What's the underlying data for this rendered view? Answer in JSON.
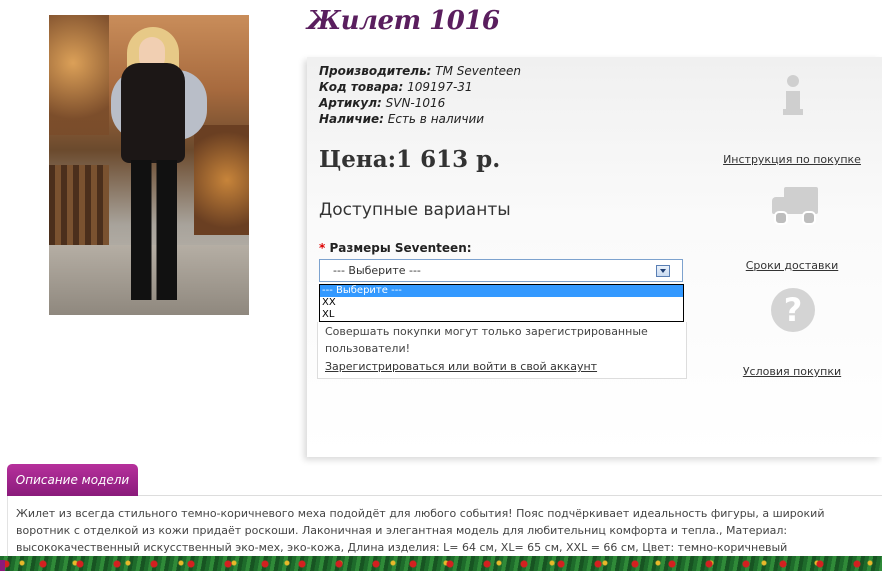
{
  "product": {
    "title": "Жилет 1016",
    "image_alt": "Жилет 1016"
  },
  "meta": {
    "manufacturer_label": "Производитель:",
    "manufacturer_value": "TM Seventeen",
    "code_label": "Код товара:",
    "code_value": "109197-31",
    "sku_label": "Артикул:",
    "sku_value": "SVN-1016",
    "availability_label": "Наличие:",
    "availability_value": "Есть в наличии"
  },
  "price": "Цена:1 613 р.",
  "variants": {
    "heading": "Доступные варианты",
    "required_mark": "*",
    "size_label": "Размеры Seventeen:",
    "selected": "--- Выберите ---",
    "options": [
      "--- Выберите ---",
      "XX",
      "XL"
    ]
  },
  "notice": {
    "text": "Совершать покупки могут только зарегистрированные пользователи!",
    "link": "Зарегистрироваться или войти в свой аккаунт"
  },
  "side_links": {
    "instructions": "Инструкция по покупке",
    "delivery": "Сроки доставки",
    "terms": "Условия покупки",
    "question_glyph": "?"
  },
  "description": {
    "tab_label": "Описание модели",
    "text": "Жилет из всегда стильного темно-коричневого меха подойдёт для любого события! Пояс подчёркивает идеальность фигуры, а широкий воротник с отделкой из кожи придаёт роскоши. Лаконичная и элегантная модель для любительниц комфорта и тепла., Материал: высококачественный искусственный эко-мех, эко-кожа, Длина изделия: L= 64 см, XL= 65 см, XXL = 66 см, Цвет: темно-коричневый"
  },
  "colors": {
    "title": "#5a1e5e",
    "tab": "#8a1b7b",
    "select_border": "#7da2ce",
    "option_highlight": "#3399ff",
    "required": "#dd0000"
  },
  "icons": [
    "info-icon",
    "truck-icon",
    "question-icon"
  ]
}
